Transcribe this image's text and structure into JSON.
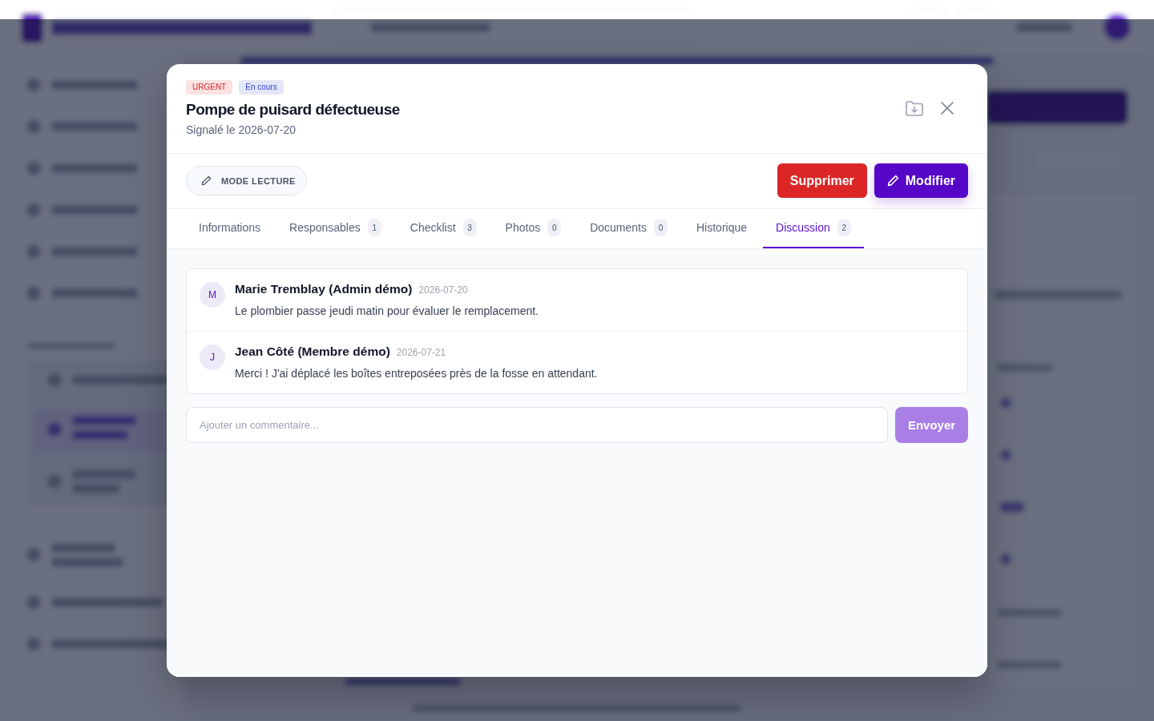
{
  "dialog": {
    "badges": [
      {
        "label": "URGENT",
        "color": "#dc2626"
      },
      {
        "label": "En cours",
        "color": "#3347d6"
      }
    ],
    "title": "Pompe de puisard défectueuse",
    "subtitle": "Signalé le 2026-07-20"
  },
  "toolbar": {
    "mode_toggle": "MODE LECTURE",
    "buttons": [
      {
        "label": "Supprimer",
        "kind": "danger"
      },
      {
        "label": "Modifier",
        "kind": "primary"
      }
    ]
  },
  "tabs": [
    {
      "label": "Informations",
      "selected": false
    },
    {
      "label": "Responsables",
      "count": "1",
      "selected": false
    },
    {
      "label": "Checklist",
      "count": "3",
      "selected": false
    },
    {
      "label": "Photos",
      "count": "0",
      "selected": false
    },
    {
      "label": "Documents",
      "count": "0",
      "selected": false
    },
    {
      "label": "Historique",
      "selected": false
    },
    {
      "label": "Discussion",
      "count": "2",
      "selected": true
    }
  ],
  "comments": [
    {
      "initial": "M",
      "author": "Marie Tremblay (Admin démo)",
      "date": "2026-07-20",
      "text": "Le plombier passe jeudi matin pour évaluer le remplacement."
    },
    {
      "initial": "J",
      "author": "Jean Côté (Membre démo)",
      "date": "2026-07-21",
      "text": "Merci ! J'ai déplacé les boîtes entreposées près de la fosse en attendant."
    }
  ],
  "composer": {
    "placeholder": "Ajouter un commentaire...",
    "send_button": {
      "label": "Envoyer",
      "disabled": true
    }
  }
}
